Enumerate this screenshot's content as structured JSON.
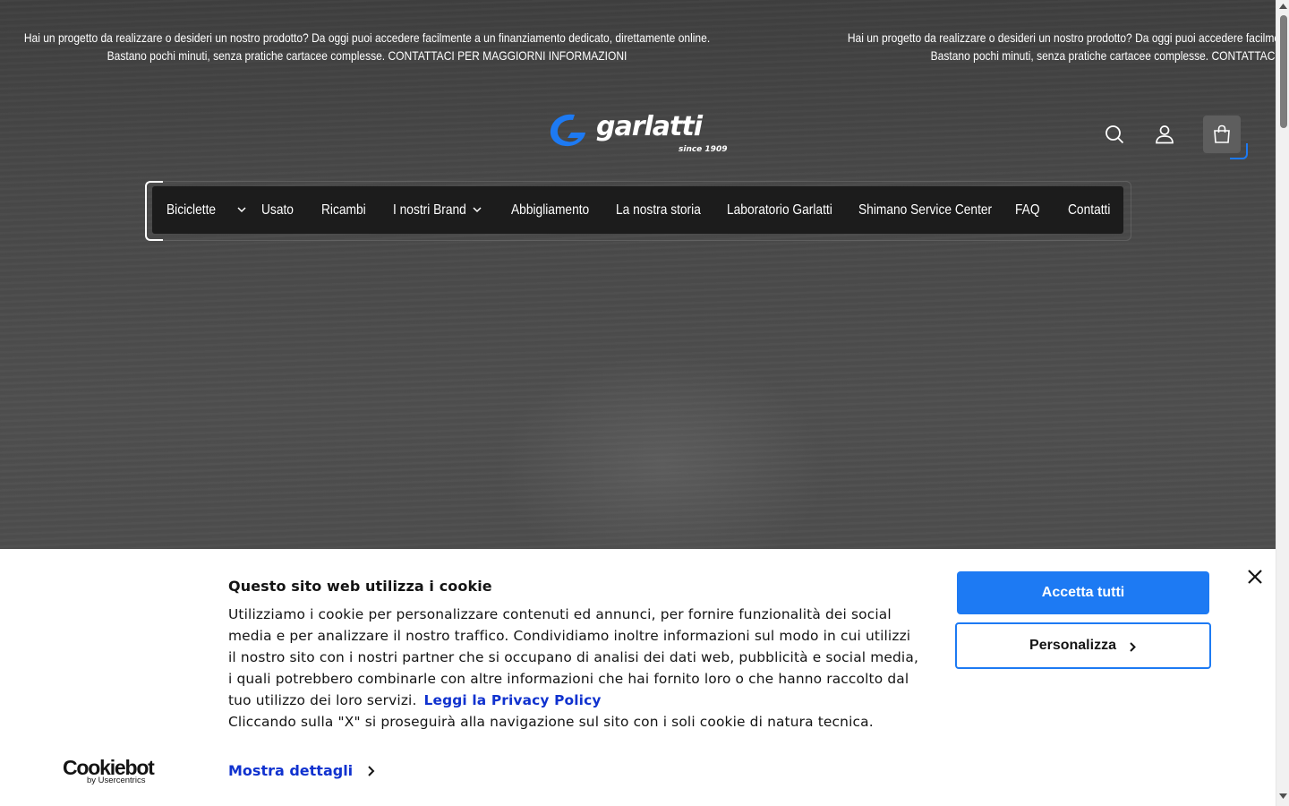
{
  "announcement": {
    "line1": "Hai un progetto da realizzare o desideri un nostro prodotto? Da oggi puoi accedere facilmente a un finanziamento dedicato, direttamente online.",
    "line2": "Bastano pochi minuti, senza pratiche cartacee complesse. CONTATTACI PER MAGGIORNI INFORMAZIONI"
  },
  "header": {
    "logo_wordmark": "garlatti",
    "logo_tagline": "since 1909",
    "icons": [
      "search-icon",
      "account-icon",
      "cart-icon"
    ]
  },
  "nav": {
    "items": [
      {
        "label": "Biciclette",
        "has_dropdown": true
      },
      {
        "label": "Usato",
        "has_dropdown": false
      },
      {
        "label": "Ricambi",
        "has_dropdown": false
      },
      {
        "label": "I nostri Brand",
        "has_dropdown": true
      },
      {
        "label": "Abbigliamento",
        "has_dropdown": false
      },
      {
        "label": "La nostra storia",
        "has_dropdown": false
      },
      {
        "label": "Laboratorio Garlatti",
        "has_dropdown": false
      },
      {
        "label": "Shimano Service Center",
        "has_dropdown": false
      },
      {
        "label": "FAQ",
        "has_dropdown": false
      },
      {
        "label": "Contatti",
        "has_dropdown": false
      }
    ]
  },
  "cookie_banner": {
    "title": "Questo sito web utilizza i cookie",
    "body_lines": [
      "Utilizziamo i cookie per personalizzare contenuti ed annunci, per fornire funzionalità dei social",
      "media e per analizzare il nostro traffico. Condividiamo inoltre informazioni sul modo in cui utilizzi",
      "il nostro sito con i nostri partner che si occupano di analisi dei dati web, pubblicità e social media,",
      "i quali potrebbero combinarle con altre informazioni che hai fornito loro o che hanno raccolto dal",
      "tuo utilizzo dei loro servizi."
    ],
    "privacy_link": "Leggi la Privacy Policy",
    "close_note": "Cliccando sulla \"X\" si proseguirà alla navigazione sul sito con i soli cookie di natura tecnica.",
    "details_link": "Mostra dettagli",
    "accept_button": "Accetta tutti",
    "customize_button": "Personalizza",
    "brand": "Cookiebot",
    "brand_sub": "by Usercentrics"
  },
  "colors": {
    "accent_blue": "#1d7af3",
    "link_blue": "#1032cf",
    "nav_bg": "#1c1c1c",
    "hero_bg": "#4a4a4a"
  }
}
